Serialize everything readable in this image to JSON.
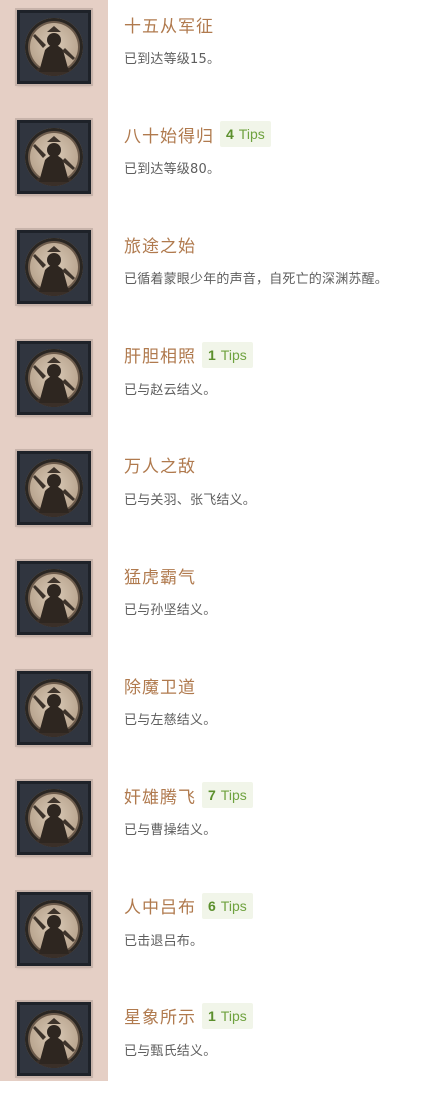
{
  "achievements": [
    {
      "title": "十五从军征",
      "tips_count": "",
      "tips_label": "",
      "desc": "已到达等级15。",
      "icon": "soldier-emblem-icon"
    },
    {
      "title": "八十始得归",
      "tips_count": "4",
      "tips_label": "Tips",
      "desc": "已到达等级80。",
      "icon": "veteran-emblem-icon"
    },
    {
      "title": "旅途之始",
      "tips_count": "",
      "tips_label": "",
      "desc": "已循着蒙眼少年的声音，自死亡的深渊苏醒。",
      "icon": "journey-emblem-icon"
    },
    {
      "title": "肝胆相照",
      "tips_count": "1",
      "tips_label": "Tips",
      "desc": "已与赵云结义。",
      "icon": "zhao-yun-emblem-icon"
    },
    {
      "title": "万人之敌",
      "tips_count": "",
      "tips_label": "",
      "desc": "已与关羽、张飞结义。",
      "icon": "guan-zhang-emblem-icon"
    },
    {
      "title": "猛虎霸气",
      "tips_count": "",
      "tips_label": "",
      "desc": "已与孙坚结义。",
      "icon": "sun-jian-emblem-icon"
    },
    {
      "title": "除魔卫道",
      "tips_count": "",
      "tips_label": "",
      "desc": "已与左慈结义。",
      "icon": "zuo-ci-emblem-icon"
    },
    {
      "title": "奸雄腾飞",
      "tips_count": "7",
      "tips_label": "Tips",
      "desc": "已与曹操结义。",
      "icon": "cao-cao-emblem-icon"
    },
    {
      "title": "人中吕布",
      "tips_count": "6",
      "tips_label": "Tips",
      "desc": "已击退吕布。",
      "icon": "lu-bu-emblem-icon"
    },
    {
      "title": "星象所示",
      "tips_count": "1",
      "tips_label": "Tips",
      "desc": "已与甄氏结义。",
      "icon": "zhen-emblem-icon"
    }
  ],
  "colors": {
    "sidebar": "#e5cfc5",
    "title": "#b07a4e",
    "tips_text": "#6fa23f",
    "tips_bg": "#f1f5e9",
    "desc": "#5e5e5e"
  }
}
